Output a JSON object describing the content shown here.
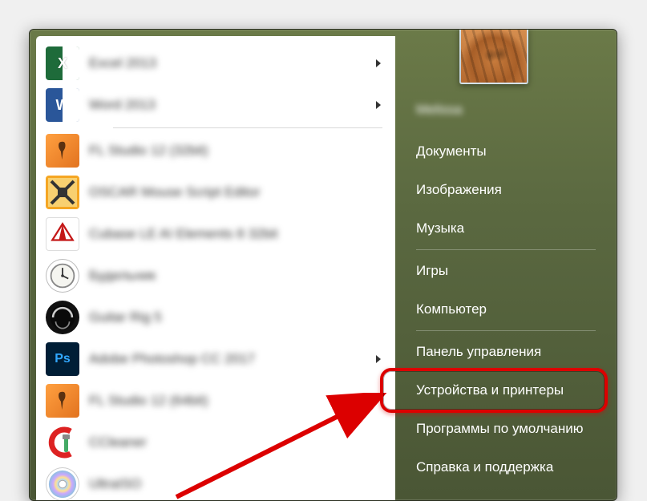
{
  "user": {
    "name": "Melissa"
  },
  "programs": [
    {
      "label": "Excel 2013",
      "icon": "excel-icon",
      "hasSubmenu": true
    },
    {
      "label": "Word 2013",
      "icon": "word-icon",
      "hasSubmenu": true,
      "separatorAfter": true
    },
    {
      "label": "FL Studio 12 (32bit)",
      "icon": "flstudio-icon",
      "hasSubmenu": false
    },
    {
      "label": "OSCAR Mouse Script Editor",
      "icon": "oscar-icon",
      "hasSubmenu": false
    },
    {
      "label": "Cubase LE AI Elements 8 32bit",
      "icon": "cubase-icon",
      "hasSubmenu": false
    },
    {
      "label": "Будильник",
      "icon": "alarm-clock-icon",
      "hasSubmenu": false
    },
    {
      "label": "Guitar Rig 5",
      "icon": "guitar-rig-icon",
      "hasSubmenu": false
    },
    {
      "label": "Adobe Photoshop CC 2017",
      "icon": "photoshop-icon",
      "hasSubmenu": true
    },
    {
      "label": "FL Studio 12 (64bit)",
      "icon": "flstudio-icon",
      "hasSubmenu": false
    },
    {
      "label": "CCleaner",
      "icon": "ccleaner-icon",
      "hasSubmenu": false
    },
    {
      "label": "UltraISO",
      "icon": "ultraiso-icon",
      "hasSubmenu": false
    }
  ],
  "rightItems": {
    "documents": "Документы",
    "pictures": "Изображения",
    "music": "Музыка",
    "games": "Игры",
    "computer": "Компьютер",
    "controlPanel": "Панель управления",
    "devicesPrinters": "Устройства и принтеры",
    "defaultPrograms": "Программы по умолчанию",
    "helpSupport": "Справка и поддержка"
  },
  "annotation": {
    "target": "devices-and-printers"
  }
}
